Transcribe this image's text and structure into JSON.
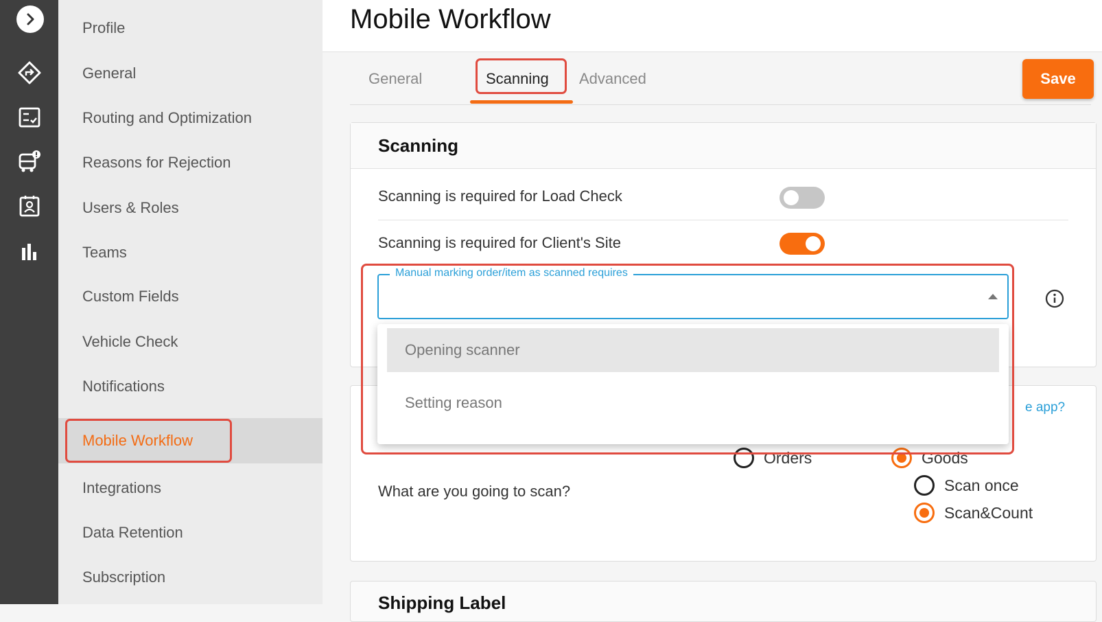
{
  "rail": {
    "items": [
      {
        "icon": "chevron-right-icon"
      },
      {
        "icon": "route-icon"
      },
      {
        "icon": "checklist-icon"
      },
      {
        "icon": "vehicle-alert-icon"
      },
      {
        "icon": "contact-card-icon"
      },
      {
        "icon": "bar-chart-icon"
      }
    ]
  },
  "sidebar": {
    "items": [
      {
        "label": "Profile"
      },
      {
        "label": "General"
      },
      {
        "label": "Routing and Optimization"
      },
      {
        "label": "Reasons for Rejection"
      },
      {
        "label": "Users & Roles"
      },
      {
        "label": "Teams"
      },
      {
        "label": "Custom Fields"
      },
      {
        "label": "Vehicle Check"
      },
      {
        "label": "Notifications"
      },
      {
        "label": "Mobile Workflow",
        "active": true
      },
      {
        "label": "Integrations"
      },
      {
        "label": "Data Retention"
      },
      {
        "label": "Subscription"
      }
    ]
  },
  "header": {
    "title": "Mobile Workflow"
  },
  "tabs": [
    {
      "label": "General"
    },
    {
      "label": "Scanning",
      "active": true
    },
    {
      "label": "Advanced"
    }
  ],
  "toolbar": {
    "save_label": "Save"
  },
  "scanning": {
    "title": "Scanning",
    "load_check_label": "Scanning is required for Load Check",
    "load_check_enabled": false,
    "client_site_label": "Scanning is required for Client's Site",
    "client_site_enabled": true,
    "manual_select": {
      "label": "Manual marking order/item as scanned requires",
      "value": "",
      "options": [
        "Opening scanner",
        "Setting reason"
      ]
    }
  },
  "second_card": {
    "help_link": "e app?",
    "question": "What are you going to scan?",
    "options": [
      {
        "label": "Orders",
        "checked": false
      },
      {
        "label": "Goods",
        "checked": true
      },
      {
        "label": "Scan once",
        "checked": false
      },
      {
        "label": "Scan&Count",
        "checked": true
      }
    ]
  },
  "third_card": {
    "title": "Shipping Label"
  },
  "colors": {
    "accent": "#f86d0f",
    "link": "#2a9fd8",
    "highlight": "#e04b3f"
  }
}
